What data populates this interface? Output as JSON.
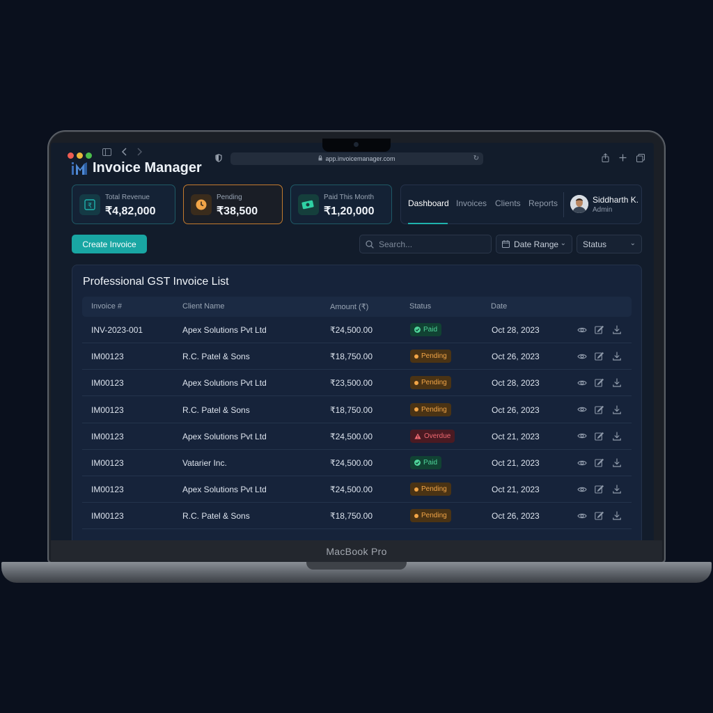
{
  "browser": {
    "url": "app.invoicemanager.com"
  },
  "app": {
    "title": "Invoice Manager",
    "accent": "#19a6a3"
  },
  "stats": [
    {
      "label": "Total Revenue",
      "value": "₹4,82,000",
      "icon": "rupee-icon",
      "color": "#1fb3ad"
    },
    {
      "label": "Pending",
      "value": "₹38,500",
      "icon": "clock-icon",
      "color": "#f2a547"
    },
    {
      "label": "Paid This Month",
      "value": "₹1,20,000",
      "icon": "cash-icon",
      "color": "#2fd1a4"
    }
  ],
  "nav": {
    "tabs": [
      "Dashboard",
      "Invoices",
      "Clients",
      "Reports"
    ],
    "active": "Dashboard"
  },
  "user": {
    "name": "Siddharth K.",
    "role": "Admin"
  },
  "toolbar": {
    "create_label": "Create Invoice",
    "search_placeholder": "Search...",
    "date_range_label": "Date Range",
    "status_label": "Status"
  },
  "table": {
    "title": "Professional GST Invoice List",
    "columns": [
      "Invoice #",
      "Client Name",
      "Amount (₹)",
      "Status",
      "Date"
    ],
    "rows": [
      {
        "invoice": "INV-2023-001",
        "client": "Apex Solutions Pvt Ltd",
        "amount": "₹24,500.00",
        "status": "Paid",
        "date": "Oct 28, 2023"
      },
      {
        "invoice": "IM00123",
        "client": "R.C. Patel & Sons",
        "amount": "₹18,750.00",
        "status": "Pending",
        "date": "Oct 26, 2023"
      },
      {
        "invoice": "IM00123",
        "client": "Apex Solutions Pvt Ltd",
        "amount": "₹23,500.00",
        "status": "Pending",
        "date": "Oct 28, 2023"
      },
      {
        "invoice": "IM00123",
        "client": "R.C. Patel & Sons",
        "amount": "₹18,750.00",
        "status": "Pending",
        "date": "Oct 26, 2023"
      },
      {
        "invoice": "IM00123",
        "client": "Apex Solutions Pvt Ltd",
        "amount": "₹24,500.00",
        "status": "Overdue",
        "date": "Oct 21, 2023"
      },
      {
        "invoice": "IM00123",
        "client": "Vatarier Inc.",
        "amount": "₹24,500.00",
        "status": "Paid",
        "date": "Oct 21, 2023"
      },
      {
        "invoice": "IM00123",
        "client": "Apex Solutions Pvt Ltd",
        "amount": "₹24,500.00",
        "status": "Pending",
        "date": "Oct 21, 2023"
      },
      {
        "invoice": "IM00123",
        "client": "R.C. Patel & Sons",
        "amount": "₹18,750.00",
        "status": "Pending",
        "date": "Oct 26, 2023"
      }
    ],
    "row_actions": [
      "eye-icon",
      "edit-icon",
      "download-icon"
    ]
  },
  "device": {
    "label": "MacBook Pro"
  },
  "status_colors": {
    "paid": "#4fd69b",
    "pending": "#f2a547",
    "overdue": "#f06a72"
  }
}
